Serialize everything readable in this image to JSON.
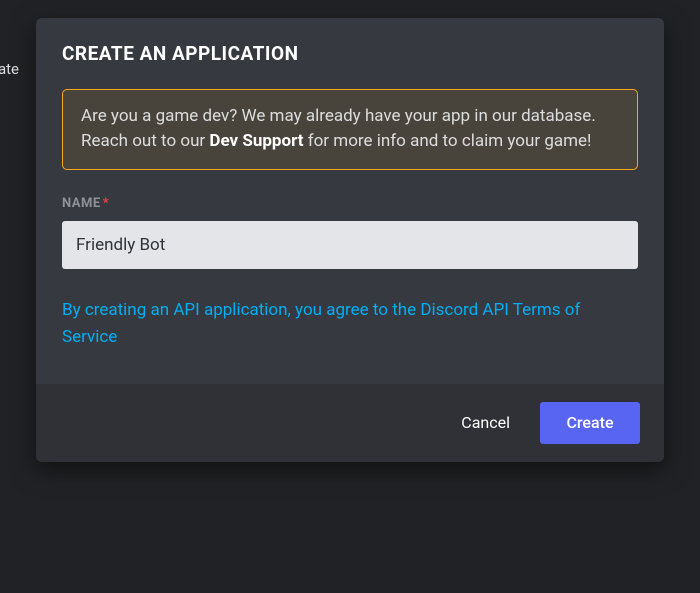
{
  "backdrop": {
    "partial_text": "eate"
  },
  "modal": {
    "title": "CREATE AN APPLICATION",
    "info": {
      "text_before": "Are you a game dev? We may already have your app in our database. Reach out to our ",
      "bold": "Dev Support",
      "text_after": " for more info and to claim your game!"
    },
    "name_field": {
      "label": "NAME",
      "required_marker": "*",
      "value": "Friendly Bot"
    },
    "tos_link": "By creating an API application, you agree to the Discord API Terms of Service",
    "buttons": {
      "cancel": "Cancel",
      "create": "Create"
    }
  }
}
